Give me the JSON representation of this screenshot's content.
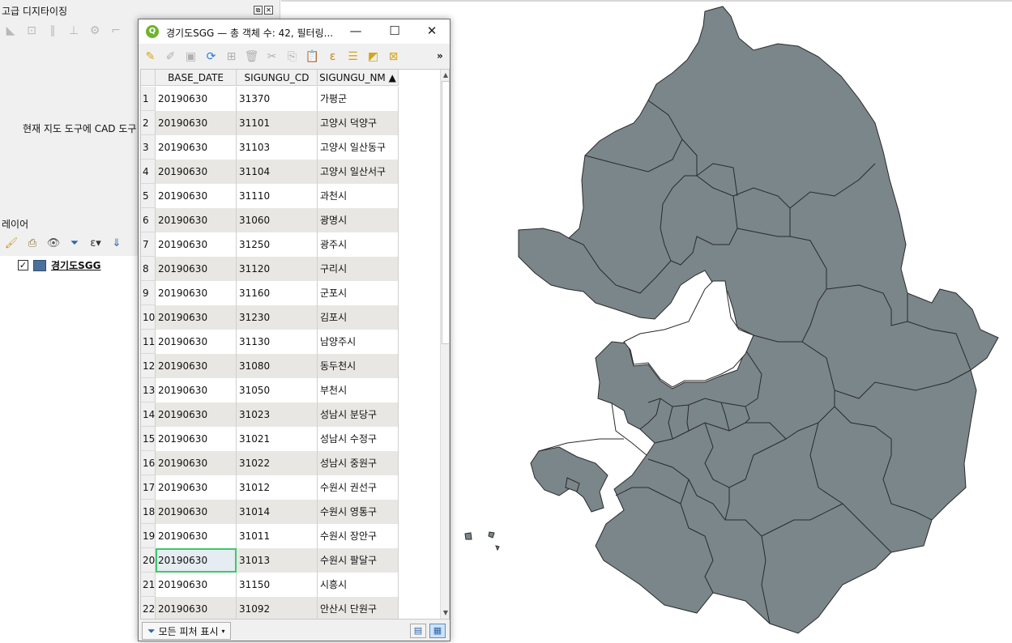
{
  "advanced_digitizing": {
    "title": "고급 디지타이징",
    "message": "현재 지도 도구에 CAD 도구",
    "float_icon": "float-icon",
    "close_icon": "close-icon"
  },
  "layers_panel": {
    "title": "레이어",
    "layers": [
      {
        "name": "경기도SGG",
        "checked": true,
        "color": "#4d7099"
      }
    ]
  },
  "attribute_table": {
    "window_title": "경기도SGG — 총 객체 수: 42, 필터링...",
    "logo_text": "Q",
    "minimize_symbol": "—",
    "maximize_symbol": "☐",
    "close_symbol": "✕",
    "more_symbol": "»",
    "columns": [
      "BASE_DATE",
      "SIGUNGU_CD",
      "SIGUNGU_NM ▲"
    ],
    "rows": [
      [
        "1",
        "20190630",
        "31370",
        "가평군"
      ],
      [
        "2",
        "20190630",
        "31101",
        "고양시 덕양구"
      ],
      [
        "3",
        "20190630",
        "31103",
        "고양시 일산동구"
      ],
      [
        "4",
        "20190630",
        "31104",
        "고양시 일산서구"
      ],
      [
        "5",
        "20190630",
        "31110",
        "과천시"
      ],
      [
        "6",
        "20190630",
        "31060",
        "광명시"
      ],
      [
        "7",
        "20190630",
        "31250",
        "광주시"
      ],
      [
        "8",
        "20190630",
        "31120",
        "구리시"
      ],
      [
        "9",
        "20190630",
        "31160",
        "군포시"
      ],
      [
        "10",
        "20190630",
        "31230",
        "김포시"
      ],
      [
        "11",
        "20190630",
        "31130",
        "남양주시"
      ],
      [
        "12",
        "20190630",
        "31080",
        "동두천시"
      ],
      [
        "13",
        "20190630",
        "31050",
        "부천시"
      ],
      [
        "14",
        "20190630",
        "31023",
        "성남시 분당구"
      ],
      [
        "15",
        "20190630",
        "31021",
        "성남시 수정구"
      ],
      [
        "16",
        "20190630",
        "31022",
        "성남시 중원구"
      ],
      [
        "17",
        "20190630",
        "31012",
        "수원시 권선구"
      ],
      [
        "18",
        "20190630",
        "31014",
        "수원시 영통구"
      ],
      [
        "19",
        "20190630",
        "31011",
        "수원시 장안구"
      ],
      [
        "20",
        "20190630",
        "31013",
        "수원시 팔달구"
      ],
      [
        "21",
        "20190630",
        "31150",
        "시흥시"
      ],
      [
        "22",
        "20190630",
        "31092",
        "안산시 단원구"
      ]
    ],
    "selected_row": 20,
    "filter_button_label": "모든 피처 표시"
  },
  "colors": {
    "map_fill": "#7a868a",
    "map_stroke": "#2a2a2a",
    "selection": "#3cc96a",
    "alt_row": "#e9e7e3"
  }
}
